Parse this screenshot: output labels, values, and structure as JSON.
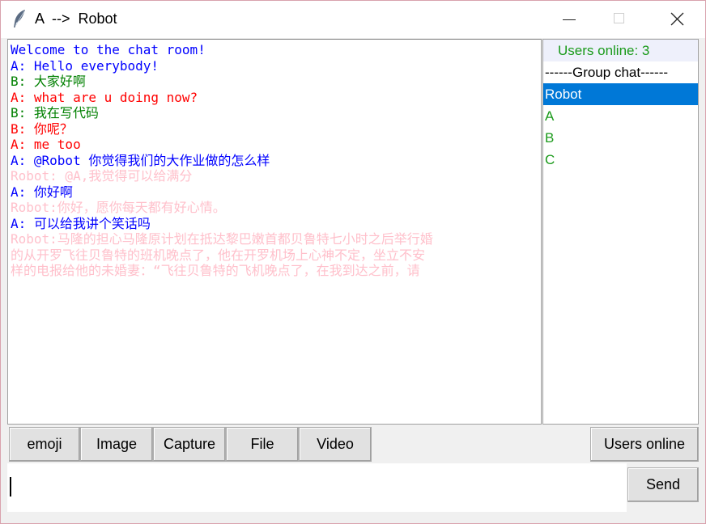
{
  "window": {
    "title": "A  -->  Robot",
    "controls": [
      "minimize",
      "maximize",
      "close"
    ]
  },
  "chat": {
    "messages": [
      {
        "text": "Welcome to the chat room!",
        "color": "#0000ff"
      },
      {
        "text": "A: Hello everybody!",
        "color": "#0000ff"
      },
      {
        "text": "B: 大家好啊",
        "color": "#008000"
      },
      {
        "text": "A: what are u doing now?",
        "color": "#ff0000"
      },
      {
        "text": "B: 我在写代码",
        "color": "#008000"
      },
      {
        "text": "B: 你呢？",
        "color": "#ff0000"
      },
      {
        "text": "A: me too",
        "color": "#ff0000"
      },
      {
        "text": "A: @Robot 你觉得我们的大作业做的怎么样",
        "color": "#0000ff"
      },
      {
        "text": "Robot: @A,我觉得可以给满分",
        "color": "#ffc0cb"
      },
      {
        "text": "A: 你好啊",
        "color": "#0000ff"
      },
      {
        "text": "Robot:你好，愿你每天都有好心情。",
        "color": "#ffc0cb"
      },
      {
        "text": "A: 可以给我讲个笑话吗",
        "color": "#0000ff"
      },
      {
        "text": "Robot:马隆的担心马隆原计划在抵达黎巴嫩首都贝鲁特七小时之后举行婚",
        "color": "#ffc0cb"
      },
      {
        "text": "的从开罗飞往贝鲁特的班机晚点了，他在开罗机场上心神不定，坐立不安",
        "color": "#ffc0cb"
      },
      {
        "text": "样的电报给他的未婚妻：“飞往贝鲁特的飞机晚点了，在我到达之前，请",
        "color": "#ffc0cb"
      }
    ]
  },
  "users": {
    "header": "Users online: 3",
    "group_label": "------Group chat------",
    "list": [
      {
        "name": "Robot",
        "selected": true
      },
      {
        "name": "A",
        "selected": false
      },
      {
        "name": "B",
        "selected": false
      },
      {
        "name": "C",
        "selected": false
      }
    ],
    "header_color": "#1a9a1a",
    "selected_color": "#0078d7"
  },
  "toolbar": {
    "emoji": "emoji",
    "image": "Image",
    "capture": "Capture",
    "file": "File",
    "video": "Video",
    "users_online": "Users online"
  },
  "input": {
    "value": "",
    "send_label": "Send"
  }
}
